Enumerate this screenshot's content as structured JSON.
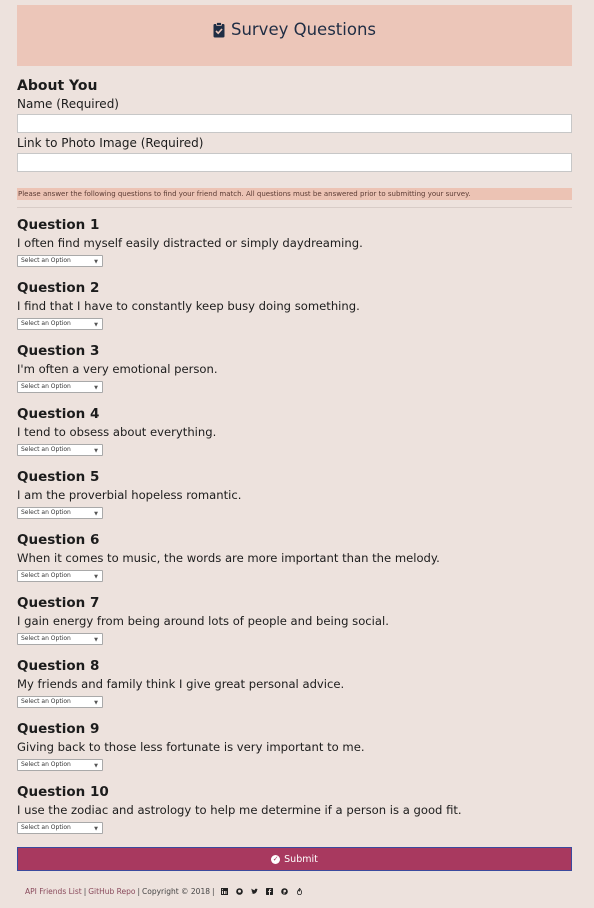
{
  "header": {
    "title": "Survey Questions",
    "icon": "clipboard-check-icon"
  },
  "about": {
    "heading": "About You",
    "name_label": "Name (Required)",
    "name_value": "",
    "photo_label": "Link to Photo Image (Required)",
    "photo_value": ""
  },
  "notice": "Please answer the following questions to find your friend match. All questions must be answered prior to submitting your survey.",
  "questions": [
    {
      "title": "Question 1",
      "text": "I often find myself easily distracted or simply daydreaming.",
      "select": "Select an Option"
    },
    {
      "title": "Question 2",
      "text": "I find that I have to constantly keep busy doing something.",
      "select": "Select an Option"
    },
    {
      "title": "Question 3",
      "text": "I'm often a very emotional person.",
      "select": "Select an Option"
    },
    {
      "title": "Question 4",
      "text": "I tend to obsess about everything.",
      "select": "Select an Option"
    },
    {
      "title": "Question 5",
      "text": "I am the proverbial hopeless romantic.",
      "select": "Select an Option"
    },
    {
      "title": "Question 6",
      "text": "When it comes to music, the words are more important than the melody.",
      "select": "Select an Option"
    },
    {
      "title": "Question 7",
      "text": "I gain energy from being around lots of people and being social.",
      "select": "Select an Option"
    },
    {
      "title": "Question 8",
      "text": "My friends and family think I give great personal advice.",
      "select": "Select an Option"
    },
    {
      "title": "Question 9",
      "text": "Giving back to those less fortunate is very important to me.",
      "select": "Select an Option"
    },
    {
      "title": "Question 10",
      "text": "I use the zodiac and astrology to help me determine if a person is a good fit.",
      "select": "Select an Option"
    }
  ],
  "submit_label": "Submit",
  "footer": {
    "link1": "API Friends List",
    "separator": "|",
    "link2": "GitHub Repo",
    "copyright": "Copyright © 2018",
    "icons": [
      "linkedin-icon",
      "github-icon",
      "twitter-icon",
      "facebook-icon",
      "pinterest-icon",
      "fire-icon"
    ]
  },
  "colors": {
    "background": "#ede2dd",
    "header_bg": "#ecc6b9",
    "notice_bg": "#ecc3b4",
    "submit_bg": "#a8395f",
    "title_text": "#1f2d44"
  }
}
